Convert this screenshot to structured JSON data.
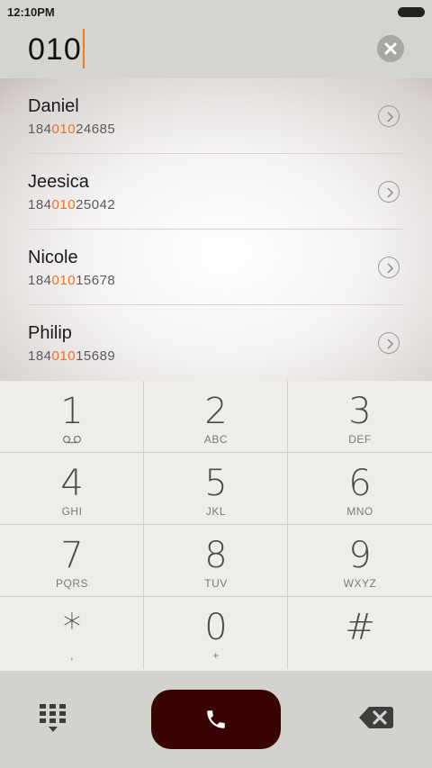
{
  "status_bar": {
    "time": "12:10PM"
  },
  "dial_input": {
    "value": "010"
  },
  "contacts": [
    {
      "name": "Daniel",
      "phone_pre": "184",
      "phone_match": "010",
      "phone_post": "24685"
    },
    {
      "name": "Jeesica",
      "phone_pre": "184",
      "phone_match": "010",
      "phone_post": "25042"
    },
    {
      "name": "Nicole",
      "phone_pre": "184",
      "phone_match": "010",
      "phone_post": "15678"
    },
    {
      "name": "Philip",
      "phone_pre": "184",
      "phone_match": "010",
      "phone_post": "15689"
    }
  ],
  "keypad": {
    "keys": [
      {
        "digit": "1",
        "letters": ""
      },
      {
        "digit": "2",
        "letters": "ABC"
      },
      {
        "digit": "3",
        "letters": "DEF"
      },
      {
        "digit": "4",
        "letters": "GHI"
      },
      {
        "digit": "5",
        "letters": "JKL"
      },
      {
        "digit": "6",
        "letters": "MNO"
      },
      {
        "digit": "7",
        "letters": "PQRS"
      },
      {
        "digit": "8",
        "letters": "TUV"
      },
      {
        "digit": "9",
        "letters": "WXYZ"
      },
      {
        "digit": "*",
        "letters": ","
      },
      {
        "digit": "0",
        "letters": "+"
      },
      {
        "digit": "#",
        "letters": ""
      }
    ]
  },
  "colors": {
    "accent": "#e8742a",
    "call_button": "#3a0303",
    "background": "#d4d5d0"
  },
  "icons": {
    "clear": "clear-circle-x-icon",
    "chevron": "chevron-right-circle-icon",
    "voicemail": "voicemail-icon",
    "dialpad": "dialpad-grid-icon",
    "call": "phone-handset-icon",
    "backspace": "backspace-icon"
  }
}
